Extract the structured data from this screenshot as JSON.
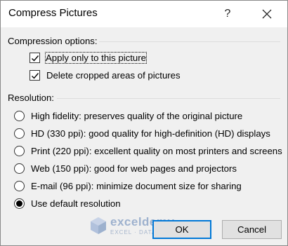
{
  "window": {
    "title": "Compress Pictures",
    "help_glyph": "?"
  },
  "compression": {
    "label": "Compression options:",
    "options": [
      {
        "label": "Apply only to this picture",
        "checked": true
      },
      {
        "label": "Delete cropped areas of pictures",
        "checked": true
      }
    ]
  },
  "resolution": {
    "label": "Resolution:",
    "options": [
      {
        "label": "High fidelity: preserves quality of the original picture",
        "selected": false
      },
      {
        "label": "HD (330 ppi): good quality for high-definition (HD) displays",
        "selected": false
      },
      {
        "label": "Print (220 ppi): excellent quality on most printers and screens",
        "selected": false
      },
      {
        "label": "Web (150 ppi): good for web pages and projectors",
        "selected": false
      },
      {
        "label": "E-mail (96 ppi): minimize document size for sharing",
        "selected": false
      },
      {
        "label": "Use default resolution",
        "selected": true
      }
    ]
  },
  "buttons": {
    "ok": "OK",
    "cancel": "Cancel"
  },
  "watermark": {
    "name": "exceldemy",
    "tagline": "EXCEL · DATA · BI"
  },
  "colors": {
    "accent": "#0078d7",
    "dialog_bg": "#f0f0f0",
    "title_bg": "#ffffff"
  }
}
